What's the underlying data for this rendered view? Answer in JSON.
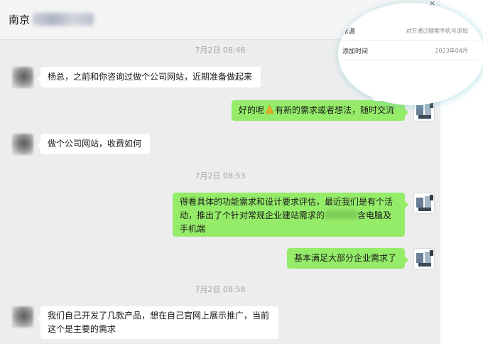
{
  "header": {
    "contact_name": "南京",
    "close_icon": "close-icon"
  },
  "contact_info_callout": {
    "source_label": "来源",
    "source_value": "对方通过搜索手机号添加",
    "added_label": "添加时间",
    "added_value": "2023年04月"
  },
  "messages": [
    {
      "type": "timestamp",
      "text": "7月2日 08:46"
    },
    {
      "type": "incoming",
      "text": "杨总，之前和你咨询过做个公司网站，近期准备做起来"
    },
    {
      "type": "outgoing",
      "text_before": "好的呢",
      "emoji": "folded-hands-emoji",
      "text_after": "有新的需求或者想法，随时交流"
    },
    {
      "type": "incoming",
      "text": "做个公司网站，收费如何"
    },
    {
      "type": "timestamp",
      "text": "7月2日 08:53"
    },
    {
      "type": "outgoing",
      "line1": "得看具体的功能需求和设计要求评估，最近我们是有个活",
      "line2_before": "动，推出了个针对常规企业建站需求的",
      "line2_after": "含电脑及",
      "line3": "手机端"
    },
    {
      "type": "outgoing",
      "text": "基本满足大部分企业需求了"
    },
    {
      "type": "timestamp",
      "text": "7月2日 08:58"
    },
    {
      "type": "incoming",
      "line1": "我们自己开发了几款产品，想在自己官网上展示推广，当前",
      "line2": "这个是主要的需求"
    }
  ],
  "colors": {
    "chat_background": "#ededed",
    "outgoing_bubble": "#95ec69",
    "incoming_bubble": "#ffffff",
    "timestamp_text": "#a5a5a5"
  }
}
